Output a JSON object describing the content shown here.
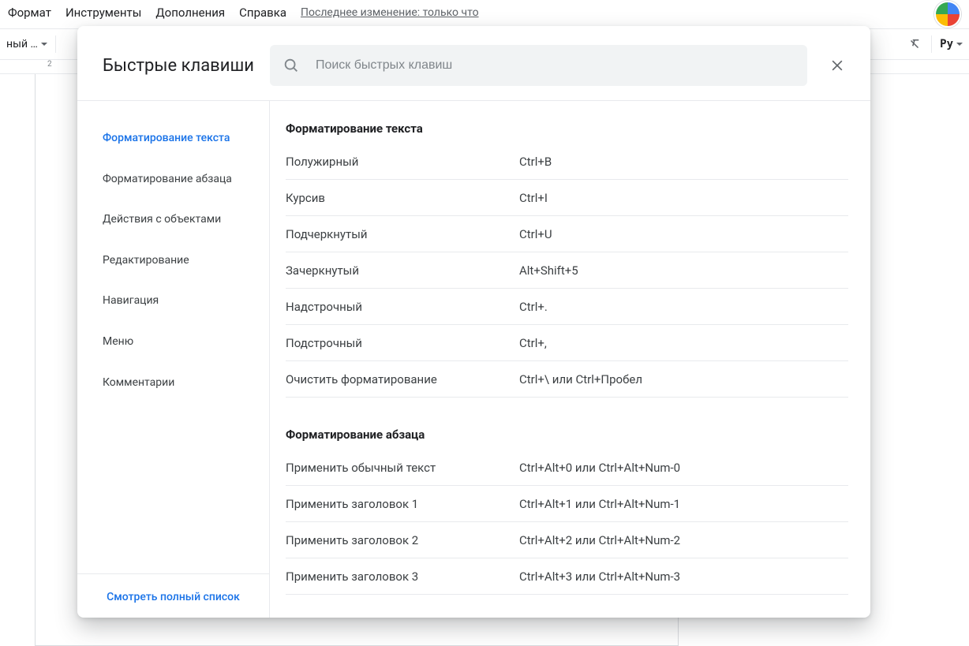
{
  "menubar": {
    "items": [
      "Формат",
      "Инструменты",
      "Дополнения",
      "Справка"
    ],
    "last_edit": "Последнее изменение: только что"
  },
  "toolbar": {
    "style_label": "ный …",
    "py_label": "Py"
  },
  "ruler": {
    "mark": "2"
  },
  "modal": {
    "title": "Быстрые клавиши",
    "search_placeholder": "Поиск быстрых клавиш",
    "close_label": "Закрыть",
    "sidebar": {
      "items": [
        "Форматирование текста",
        "Форматирование абзаца",
        "Действия с объектами",
        "Редактирование",
        "Навигация",
        "Меню",
        "Комментарии"
      ],
      "active_index": 0,
      "footer": "Смотреть полный список"
    },
    "sections": [
      {
        "title": "Форматирование текста",
        "rows": [
          {
            "name": "Полужирный",
            "keys": "Ctrl+B"
          },
          {
            "name": "Курсив",
            "keys": "Ctrl+I"
          },
          {
            "name": "Подчеркнутый",
            "keys": "Ctrl+U"
          },
          {
            "name": "Зачеркнутый",
            "keys": "Alt+Shift+5"
          },
          {
            "name": "Надстрочный",
            "keys": "Ctrl+."
          },
          {
            "name": "Подстрочный",
            "keys": "Ctrl+,"
          },
          {
            "name": "Очистить форматирование",
            "keys": "Ctrl+\\ или Ctrl+Пробел"
          }
        ]
      },
      {
        "title": "Форматирование абзаца",
        "rows": [
          {
            "name": "Применить обычный текст",
            "keys": "Ctrl+Alt+0 или Ctrl+Alt+Num-0"
          },
          {
            "name": "Применить заголовок 1",
            "keys": "Ctrl+Alt+1 или Ctrl+Alt+Num-1"
          },
          {
            "name": "Применить заголовок 2",
            "keys": "Ctrl+Alt+2 или Ctrl+Alt+Num-2"
          },
          {
            "name": "Применить заголовок 3",
            "keys": "Ctrl+Alt+3 или Ctrl+Alt+Num-3"
          }
        ]
      }
    ]
  }
}
